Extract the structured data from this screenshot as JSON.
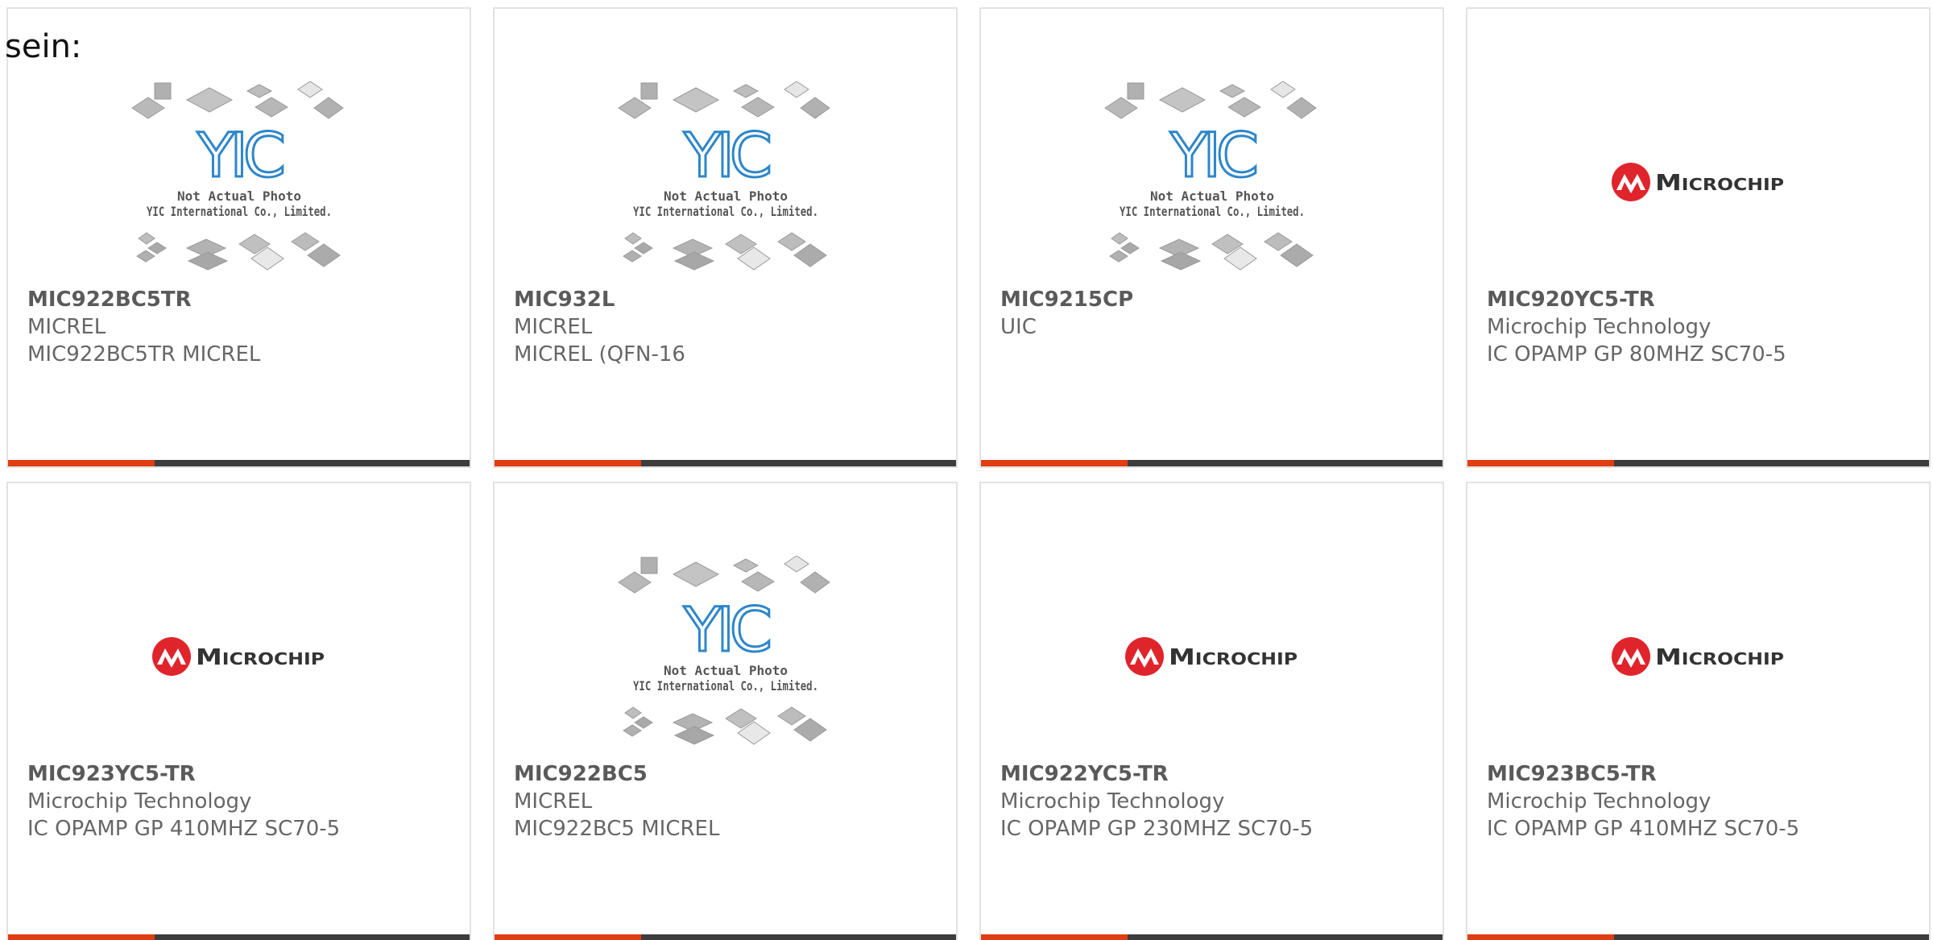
{
  "intro_text": "sein:",
  "yic_logo": {
    "logo_text": "YIC",
    "caption_line1": "Not Actual Photo",
    "caption_line2": "YIC International Co., Limited."
  },
  "microchip_logo": {
    "logo_text": "Microchip"
  },
  "colors": {
    "accent": "#e13d12",
    "bar_dark": "#3d3d3d",
    "yic_blue": "#2e86c9",
    "microchip_red": "#e0242c"
  },
  "products": [
    {
      "part": "MIC922BC5TR",
      "maker": "MICREL",
      "description": "MIC922BC5TR MICREL",
      "image": "yic"
    },
    {
      "part": "MIC932L",
      "maker": "MICREL",
      "description": "MICREL (QFN-16",
      "image": "yic"
    },
    {
      "part": "MIC9215CP",
      "maker": "UIC",
      "description": "",
      "image": "yic"
    },
    {
      "part": "MIC920YC5-TR",
      "maker": "Microchip Technology",
      "description": "IC OPAMP GP 80MHZ SC70-5",
      "image": "microchip"
    },
    {
      "part": "MIC923YC5-TR",
      "maker": "Microchip Technology",
      "description": "IC OPAMP GP 410MHZ SC70-5",
      "image": "microchip"
    },
    {
      "part": "MIC922BC5",
      "maker": "MICREL",
      "description": "MIC922BC5 MICREL",
      "image": "yic"
    },
    {
      "part": "MIC922YC5-TR",
      "maker": "Microchip Technology",
      "description": "IC OPAMP GP 230MHZ SC70-5",
      "image": "microchip"
    },
    {
      "part": "MIC923BC5-TR",
      "maker": "Microchip Technology",
      "description": "IC OPAMP GP 410MHZ SC70-5",
      "image": "microchip"
    }
  ]
}
